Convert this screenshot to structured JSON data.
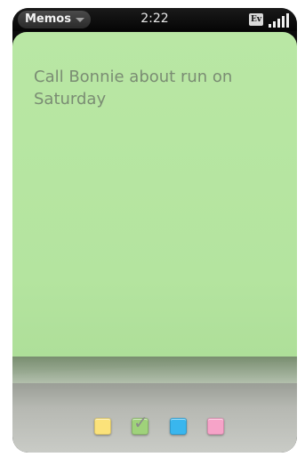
{
  "status_bar": {
    "app_menu_label": "Memos",
    "time": "2:22",
    "network_badge": "Ev"
  },
  "memo": {
    "text": "Call Bonnie about run on Saturday",
    "color": "#b6e6a1"
  },
  "color_picker": {
    "swatches": [
      {
        "name": "yellow",
        "color": "#fbe27a",
        "selected": false
      },
      {
        "name": "green",
        "color": "#9fd27a",
        "selected": true
      },
      {
        "name": "blue",
        "color": "#39b6ee",
        "selected": false
      },
      {
        "name": "pink",
        "color": "#f6a3c8",
        "selected": false
      }
    ]
  },
  "icons": {
    "menu_caret": "chevron-down-icon",
    "signal": "signal-strength-icon",
    "selected_mark": "checkmark-icon"
  }
}
